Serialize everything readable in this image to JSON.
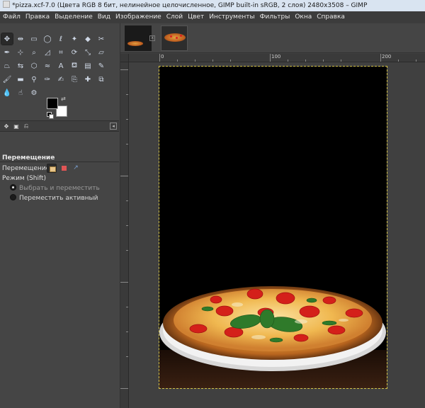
{
  "window": {
    "title": "*pizza.xcf-7.0 (Цвета RGB 8 бит, нелинейное целочисленное, GIMP built-in sRGB, 2 слоя) 2480x3508 – GIMP"
  },
  "menubar": {
    "items": [
      "Файл",
      "Правка",
      "Выделение",
      "Вид",
      "Изображение",
      "Слой",
      "Цвет",
      "Инструменты",
      "Фильтры",
      "Окна",
      "Справка"
    ]
  },
  "toolbox": {
    "active_tool": "move-tool",
    "foreground_color": "#000000",
    "background_color": "#ffffff"
  },
  "tool_options": {
    "title": "Перемещение",
    "move_label": "Перемещение:",
    "mode_label": "Режим (Shift)",
    "options": [
      {
        "label": "Выбрать и переместить",
        "checked": true
      },
      {
        "label": "Переместить активный",
        "checked": false
      }
    ]
  },
  "rulers": {
    "horizontal_labels": [
      "0",
      "100",
      "200"
    ]
  },
  "colors": {
    "ui_background": "#454545",
    "selection_outline": "#d4c24a",
    "titlebar": "#d9e4f1"
  }
}
